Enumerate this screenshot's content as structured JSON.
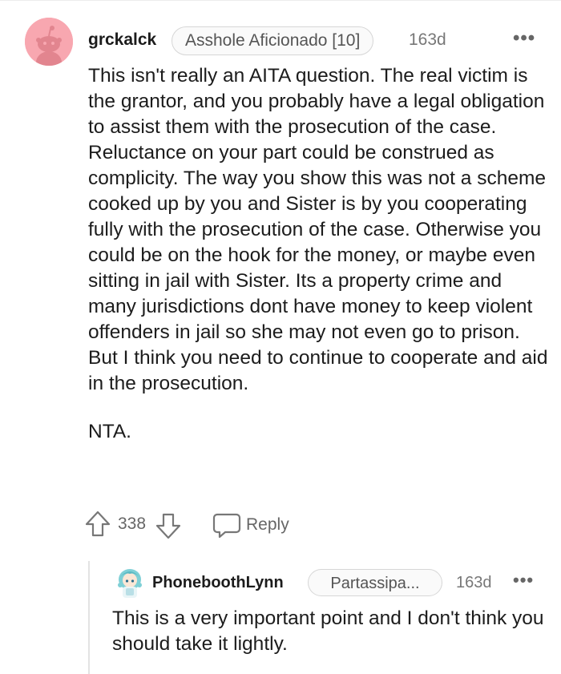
{
  "comment": {
    "username": "grckalck",
    "flair": "Asshole Aficionado [10]",
    "time": "163d",
    "more": "•••",
    "paragraphs": [
      "This isn't really an AITA question. The real victim is the grantor, and you probably have a legal obligation to assist them with the prosecution of the case. Reluctance on your part could be construed as complicity. The way you show this was not a scheme cooked up by you and Sister is by you cooperating fully with the prosecution of the case. Otherwise you could be on the hook for the money, or maybe even sitting in jail with Sister. Its a property crime and many jurisdictions dont have money to keep violent offenders in jail so she may not even go to prison. But I think you need to continue to cooperate and aid in the prosecution.",
      "NTA."
    ],
    "votes": "338",
    "reply_label": "Reply",
    "avatar_color": "#f8a7b0"
  },
  "reply": {
    "username": "PhoneboothLynn",
    "flair": "Partassipa...",
    "time": "163d",
    "more": "•••",
    "text": "This is a very important point and I don't think you should take it lightly."
  },
  "icons": {
    "upvote": "upvote-arrow-icon",
    "downvote": "downvote-arrow-icon",
    "reply": "speech-bubble-icon",
    "more": "more-options-icon"
  }
}
